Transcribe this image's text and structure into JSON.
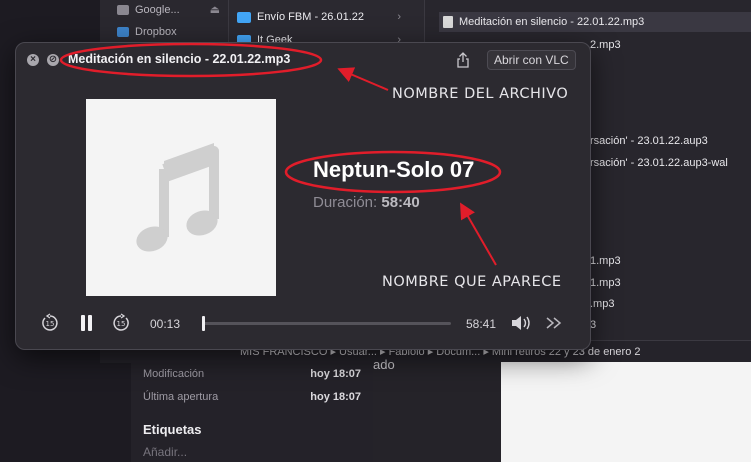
{
  "finder": {
    "sidebar": [
      {
        "label": "Google...",
        "icon": "folder-icon"
      },
      {
        "label": "Dropbox",
        "icon": "dropbox-icon"
      }
    ],
    "column2": [
      {
        "label": "Envío FBM - 26.01.22"
      },
      {
        "label": "It Geek"
      }
    ],
    "files": [
      "Meditación en silencio - 22.01.22.mp3",
      "2.mp3",
      "rsación' - 23.01.22.aup3",
      "rsación' - 23.01.22.aup3-wal",
      "1.mp3",
      "1.mp3",
      ".mp3",
      "3"
    ],
    "path_bar": "MIS FRANCISCO  ▸  Usuar...  ▸  Fabiolo  ▸  Docum...  ▸  Mini retiros 22 y 23 de enero 2",
    "info": {
      "modified_label": "Modificación",
      "modified_value": "hoy 18:07",
      "opened_label": "Última apertura",
      "opened_value": "hoy 18:07",
      "tags_heading": "Etiquetas",
      "tags_placeholder": "Añadir...",
      "partial_text": "ado"
    }
  },
  "quicklook": {
    "title": "Meditación en silencio - 22.01.22.mp3",
    "open_with": "Abrir con VLC",
    "track_title": "Neptun-Solo 07",
    "duration_label": "Duración:",
    "duration_value": "58:40",
    "elapsed": "00:13",
    "total": "58:41",
    "progress_fraction": 0.004
  },
  "annotations": {
    "file_name": "NOMBRE DEL ARCHIVO",
    "shown_name": "NOMBRE QUE APARECE"
  },
  "colors": {
    "annotation_red": "#e11d2a",
    "window_bg": "#2c2a30",
    "folder_blue": "#42a5f5"
  }
}
